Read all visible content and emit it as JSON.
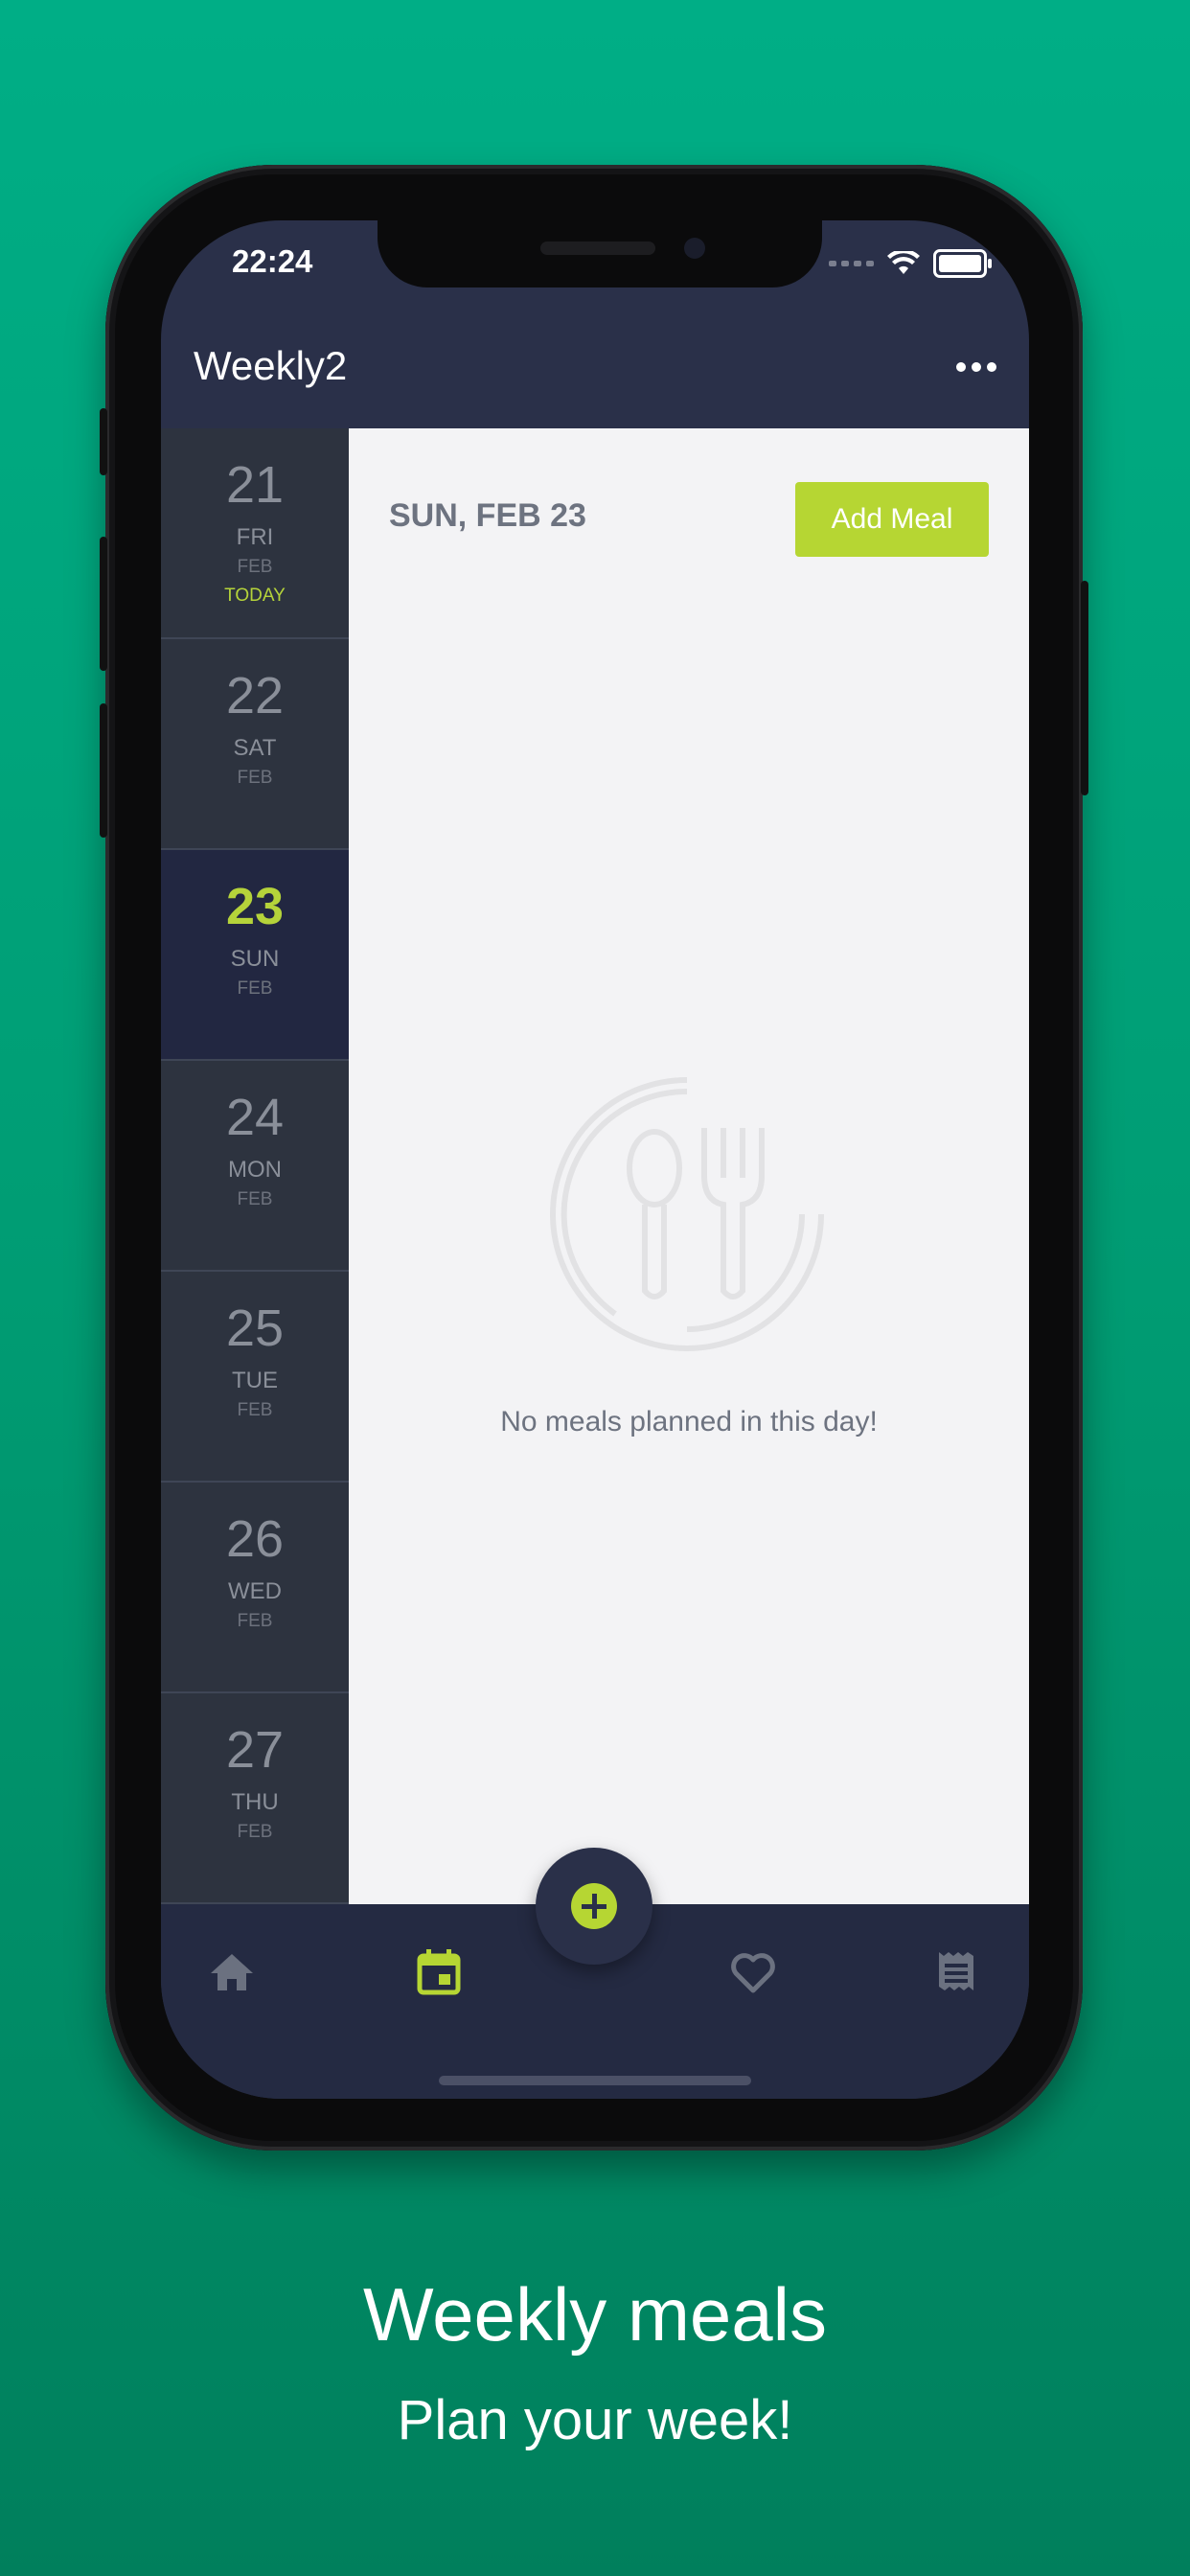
{
  "status_bar": {
    "time": "22:24"
  },
  "nav": {
    "title": "Weekly2",
    "more_icon": "more-horizontal-icon"
  },
  "days": [
    {
      "num": "21",
      "dow": "FRI",
      "month": "FEB",
      "badge": "TODAY",
      "selected": false
    },
    {
      "num": "22",
      "dow": "SAT",
      "month": "FEB",
      "badge": "",
      "selected": false
    },
    {
      "num": "23",
      "dow": "SUN",
      "month": "FEB",
      "badge": "",
      "selected": true
    },
    {
      "num": "24",
      "dow": "MON",
      "month": "FEB",
      "badge": "",
      "selected": false
    },
    {
      "num": "25",
      "dow": "TUE",
      "month": "FEB",
      "badge": "",
      "selected": false
    },
    {
      "num": "26",
      "dow": "WED",
      "month": "FEB",
      "badge": "",
      "selected": false
    },
    {
      "num": "27",
      "dow": "THU",
      "month": "FEB",
      "badge": "",
      "selected": false
    }
  ],
  "content": {
    "date_header": "SUN, FEB 23",
    "add_meal_label": "Add Meal",
    "empty_message": "No meals planned in this day!",
    "empty_icon": "plate-cutlery-icon"
  },
  "tabbar": {
    "tabs": [
      {
        "name": "home",
        "icon": "home-icon",
        "active": false
      },
      {
        "name": "calendar",
        "icon": "calendar-icon",
        "active": true
      },
      {
        "name": "favorites",
        "icon": "heart-icon",
        "active": false
      },
      {
        "name": "list",
        "icon": "receipt-icon",
        "active": false
      }
    ],
    "fab_icon": "plus-circle-icon"
  },
  "caption": {
    "title": "Weekly meals",
    "subtitle": "Plan your week!"
  },
  "colors": {
    "background_top": "#00ae86",
    "background_bottom": "#007f5c",
    "navbar": "#2a3049",
    "accent": "#b6d633",
    "sidebar": "#2d333f",
    "selected_day": "#222741",
    "content_bg": "#f3f3f5"
  }
}
